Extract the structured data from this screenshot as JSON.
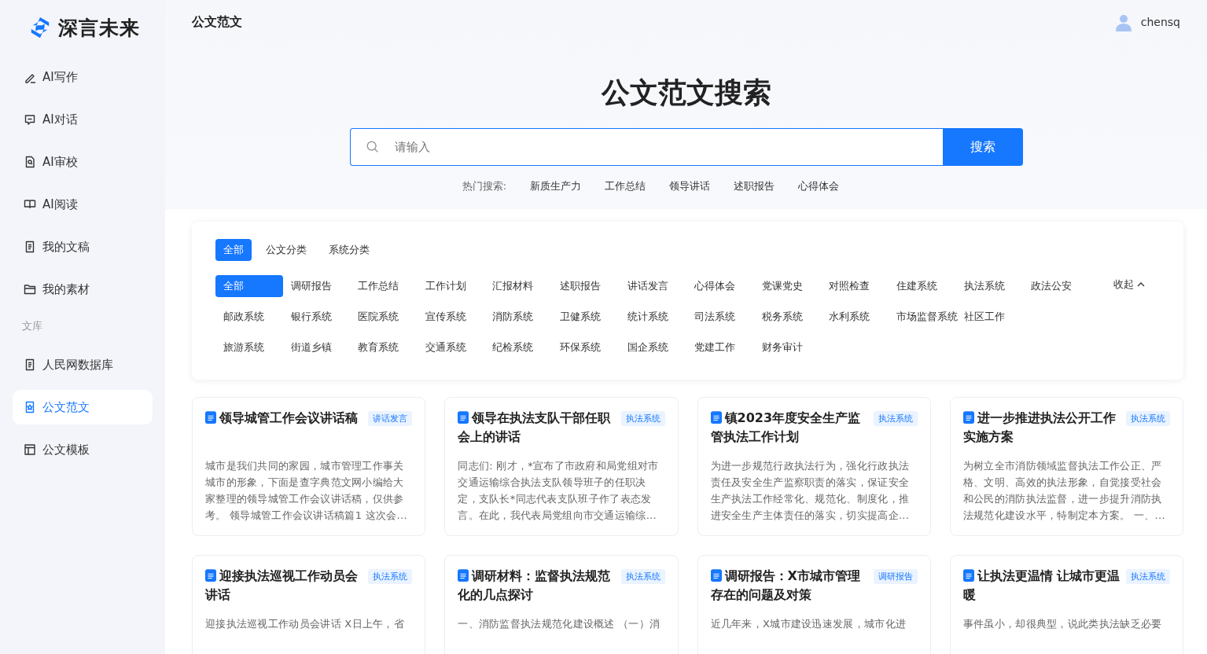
{
  "brand": {
    "name": "深言未来"
  },
  "sidebar": {
    "items": [
      {
        "label": "AI写作",
        "selected": false
      },
      {
        "label": "AI对话",
        "selected": false
      },
      {
        "label": "AI审校",
        "selected": false
      },
      {
        "label": "AI阅读",
        "selected": false
      },
      {
        "label": "我的文稿",
        "selected": false
      },
      {
        "label": "我的素材",
        "selected": false
      }
    ],
    "section": "文库",
    "library": [
      {
        "label": "人民网数据库",
        "selected": false
      },
      {
        "label": "公文范文",
        "selected": true
      },
      {
        "label": "公文模板",
        "selected": false
      }
    ]
  },
  "header": {
    "title": "公文范文",
    "user": "chensq"
  },
  "hero": {
    "title": "公文范文搜索",
    "search": {
      "placeholder": "请输入",
      "button": "搜索"
    },
    "hot_label": "热门搜索:",
    "hot": [
      "新质生产力",
      "工作总结",
      "领导讲话",
      "述职报告",
      "心得体会"
    ]
  },
  "filter": {
    "tabs": [
      {
        "label": "全部",
        "selected": true
      },
      {
        "label": "公文分类",
        "selected": false
      },
      {
        "label": "系统分类",
        "selected": false
      }
    ],
    "collapse": "收起",
    "category_rows": [
      [
        {
          "label": "全部",
          "selected": true
        },
        {
          "label": "调研报告",
          "selected": false
        },
        {
          "label": "工作总结",
          "selected": false
        },
        {
          "label": "工作计划",
          "selected": false
        },
        {
          "label": "汇报材料",
          "selected": false
        },
        {
          "label": "述职报告",
          "selected": false
        },
        {
          "label": "讲话发言",
          "selected": false
        },
        {
          "label": "心得体会",
          "selected": false
        },
        {
          "label": "党课党史",
          "selected": false
        },
        {
          "label": "对照检查",
          "selected": false
        },
        {
          "label": "住建系统",
          "selected": false
        },
        {
          "label": "执法系统",
          "selected": false
        },
        {
          "label": "政法公安",
          "selected": false
        }
      ],
      [
        {
          "label": "邮政系统",
          "selected": false
        },
        {
          "label": "银行系统",
          "selected": false
        },
        {
          "label": "医院系统",
          "selected": false
        },
        {
          "label": "宣传系统",
          "selected": false
        },
        {
          "label": "消防系统",
          "selected": false
        },
        {
          "label": "卫健系统",
          "selected": false
        },
        {
          "label": "统计系统",
          "selected": false
        },
        {
          "label": "司法系统",
          "selected": false
        },
        {
          "label": "税务系统",
          "selected": false
        },
        {
          "label": "水利系统",
          "selected": false
        },
        {
          "label": "市场监督系统",
          "selected": false
        },
        {
          "label": "社区工作",
          "selected": false
        }
      ],
      [
        {
          "label": "旅游系统",
          "selected": false
        },
        {
          "label": "街道乡镇",
          "selected": false
        },
        {
          "label": "教育系统",
          "selected": false
        },
        {
          "label": "交通系统",
          "selected": false
        },
        {
          "label": "纪检系统",
          "selected": false
        },
        {
          "label": "环保系统",
          "selected": false
        },
        {
          "label": "国企系统",
          "selected": false
        },
        {
          "label": "党建工作",
          "selected": false
        },
        {
          "label": "财务审计",
          "selected": false
        }
      ]
    ]
  },
  "articles": [
    {
      "title": "领导城管工作会议讲话稿",
      "tag": "讲话发言",
      "summary": "城市是我们共同的家园，城市管理工作事关城市的形象，下面是查字典范文网小编给大家整理的领导城管工作会议讲话稿，仅供参考。 领导城管工作会议讲话稿篇1 这次会..."
    },
    {
      "title": "领导在执法支队干部任职会上的讲话",
      "tag": "执法系统",
      "summary": "同志们: 刚才，*宣布了市政府和局党组对市交通运输综合执法支队领导班子的任职决定，支队长*同志代表支队班子作了表态发言。在此，我代表局党组向市交通运输综..."
    },
    {
      "title": "镇2023年度安全生产监管执法工作计划",
      "tag": "执法系统",
      "summary": "为进一步规范行政执法行为，强化行政执法责任及安全生产监察职责的落实，保证安全生产执法工作经常化、规范化、制度化，推进安全生产主体责任的落实，切实提高企..."
    },
    {
      "title": "进一步推进执法公开工作实施方案",
      "tag": "执法系统",
      "summary": "为树立全市消防领域监督执法工作公正、严格、文明、高效的执法形象，自觉接受社会和公民的消防执法监督，进一步提升消防执法规范化建设水平，特制定本方案。 一、..."
    },
    {
      "title": "迎接执法巡视工作动员会讲话",
      "tag": "执法系统",
      "summary": "迎接执法巡视工作动员会讲话 X日上午，省"
    },
    {
      "title": "调研材料：监督执法规范化的几点探讨",
      "tag": "执法系统",
      "summary": "一、消防监督执法规范化建设概述 （一）消"
    },
    {
      "title": "调研报告：X市城市管理存在的问题及对策",
      "tag": "调研报告",
      "summary": "近几年来，X城市建设迅速发展，城市化进"
    },
    {
      "title": "让执法更温情 让城市更温暖",
      "tag": "执法系统",
      "summary": "事件虽小，却很典型，说此类执法缺乏必要"
    }
  ]
}
